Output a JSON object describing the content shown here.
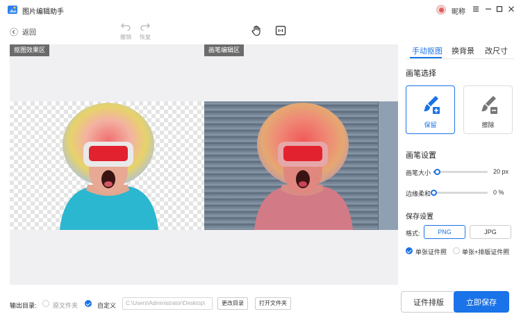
{
  "app": {
    "title": "图片编辑助手"
  },
  "user": {
    "nickname": "昵称"
  },
  "toolbar": {
    "back_label": "返回",
    "undo_label": "撤销",
    "redo_label": "恢复"
  },
  "canvas": {
    "left_pane_label": "抠图效果区",
    "right_pane_label": "画笔编辑区"
  },
  "panel": {
    "tabs": [
      {
        "label": "手动抠图",
        "active": true
      },
      {
        "label": "换背景",
        "active": false
      },
      {
        "label": "改尺寸",
        "active": false
      }
    ],
    "brush_select_title": "画笔选择",
    "brush_keep_label": "保留",
    "brush_erase_label": "擦除",
    "brush_settings_title": "画笔设置",
    "brush_size_label": "画笔大小",
    "brush_size_value": "20 px",
    "brush_size_fraction": 0.07,
    "edge_soft_label": "边缘柔和",
    "edge_soft_value": "0 %",
    "edge_soft_fraction": 0.0,
    "save_settings_title": "保存设置",
    "format_label": "格式:",
    "format_png": "PNG",
    "format_jpg": "JPG",
    "selected_format": "PNG",
    "option_single": "单张证件照",
    "option_single_layout": "单张+排版证件照"
  },
  "bottom": {
    "output_dir_label": "输出目录:",
    "option_original": "原文件夹",
    "option_custom": "自定义",
    "path_value": "C:\\Users\\Administrator\\Desktop\\",
    "change_dir_button": "更改目录",
    "open_folder_button": "打开文件夹",
    "layout_button": "证件排版",
    "save_button": "立即保存"
  },
  "colors": {
    "accent": "#1a73e8",
    "tag_bg": "#6b6b6b"
  }
}
